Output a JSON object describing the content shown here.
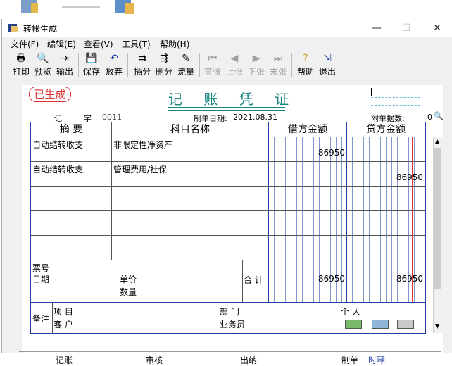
{
  "window": {
    "title": "转帐生成"
  },
  "menu": [
    "文件(F)",
    "编辑(E)",
    "查看(V)",
    "工具(T)",
    "帮助(H)"
  ],
  "toolbar": {
    "print": "打印",
    "preview": "预览",
    "export": "输出",
    "save": "保存",
    "discard": "放弃",
    "insert": "插分",
    "delete": "删分",
    "flow": "流量",
    "first": "首张",
    "prev": "上张",
    "next": "下张",
    "last": "末张",
    "help": "帮助",
    "exit": "退出"
  },
  "voucher": {
    "stamp": "已生成",
    "title": "记 账 凭 证",
    "type_label": "记",
    "char_label": "字",
    "number": "0011",
    "date_label": "制单日期:",
    "date": "2021.08.31",
    "attachments_label": "附单据数:",
    "attachments": "0",
    "headers": {
      "summary": "摘 要",
      "account": "科目名称",
      "debit": "借方金额",
      "credit": "贷方金额"
    },
    "rows": [
      {
        "summary": "自动结转收支",
        "account": "非限定性净资产",
        "debit": "86950",
        "credit": ""
      },
      {
        "summary": "自动结转收支",
        "account": "管理费用/社保",
        "debit": "",
        "credit": "86950"
      },
      {
        "summary": "",
        "account": "",
        "debit": "",
        "credit": ""
      },
      {
        "summary": "",
        "account": "",
        "debit": "",
        "credit": ""
      },
      {
        "summary": "",
        "account": "",
        "debit": "",
        "credit": ""
      }
    ],
    "bill_no_label": "票号",
    "bill_date_label": "日期",
    "unit_price_label": "单价",
    "quantity_label": "数量",
    "total_label": "合 计",
    "total_debit": "86950",
    "total_credit": "86950",
    "remark_label": "备注",
    "project_label": "项    目",
    "customer_label": "客    户",
    "dept_label": "部    门",
    "person_label": "个    人",
    "salesman_label": "业务员"
  },
  "footer": {
    "bookkeeper": "记账",
    "reviewer": "审核",
    "cashier": "出纳",
    "maker_label": "制单",
    "maker": "时琴"
  },
  "colors": {
    "accent": "#15847e",
    "grid": "#1f3fa6",
    "stamp": "#d33333",
    "maker": "#1f3fa6"
  }
}
